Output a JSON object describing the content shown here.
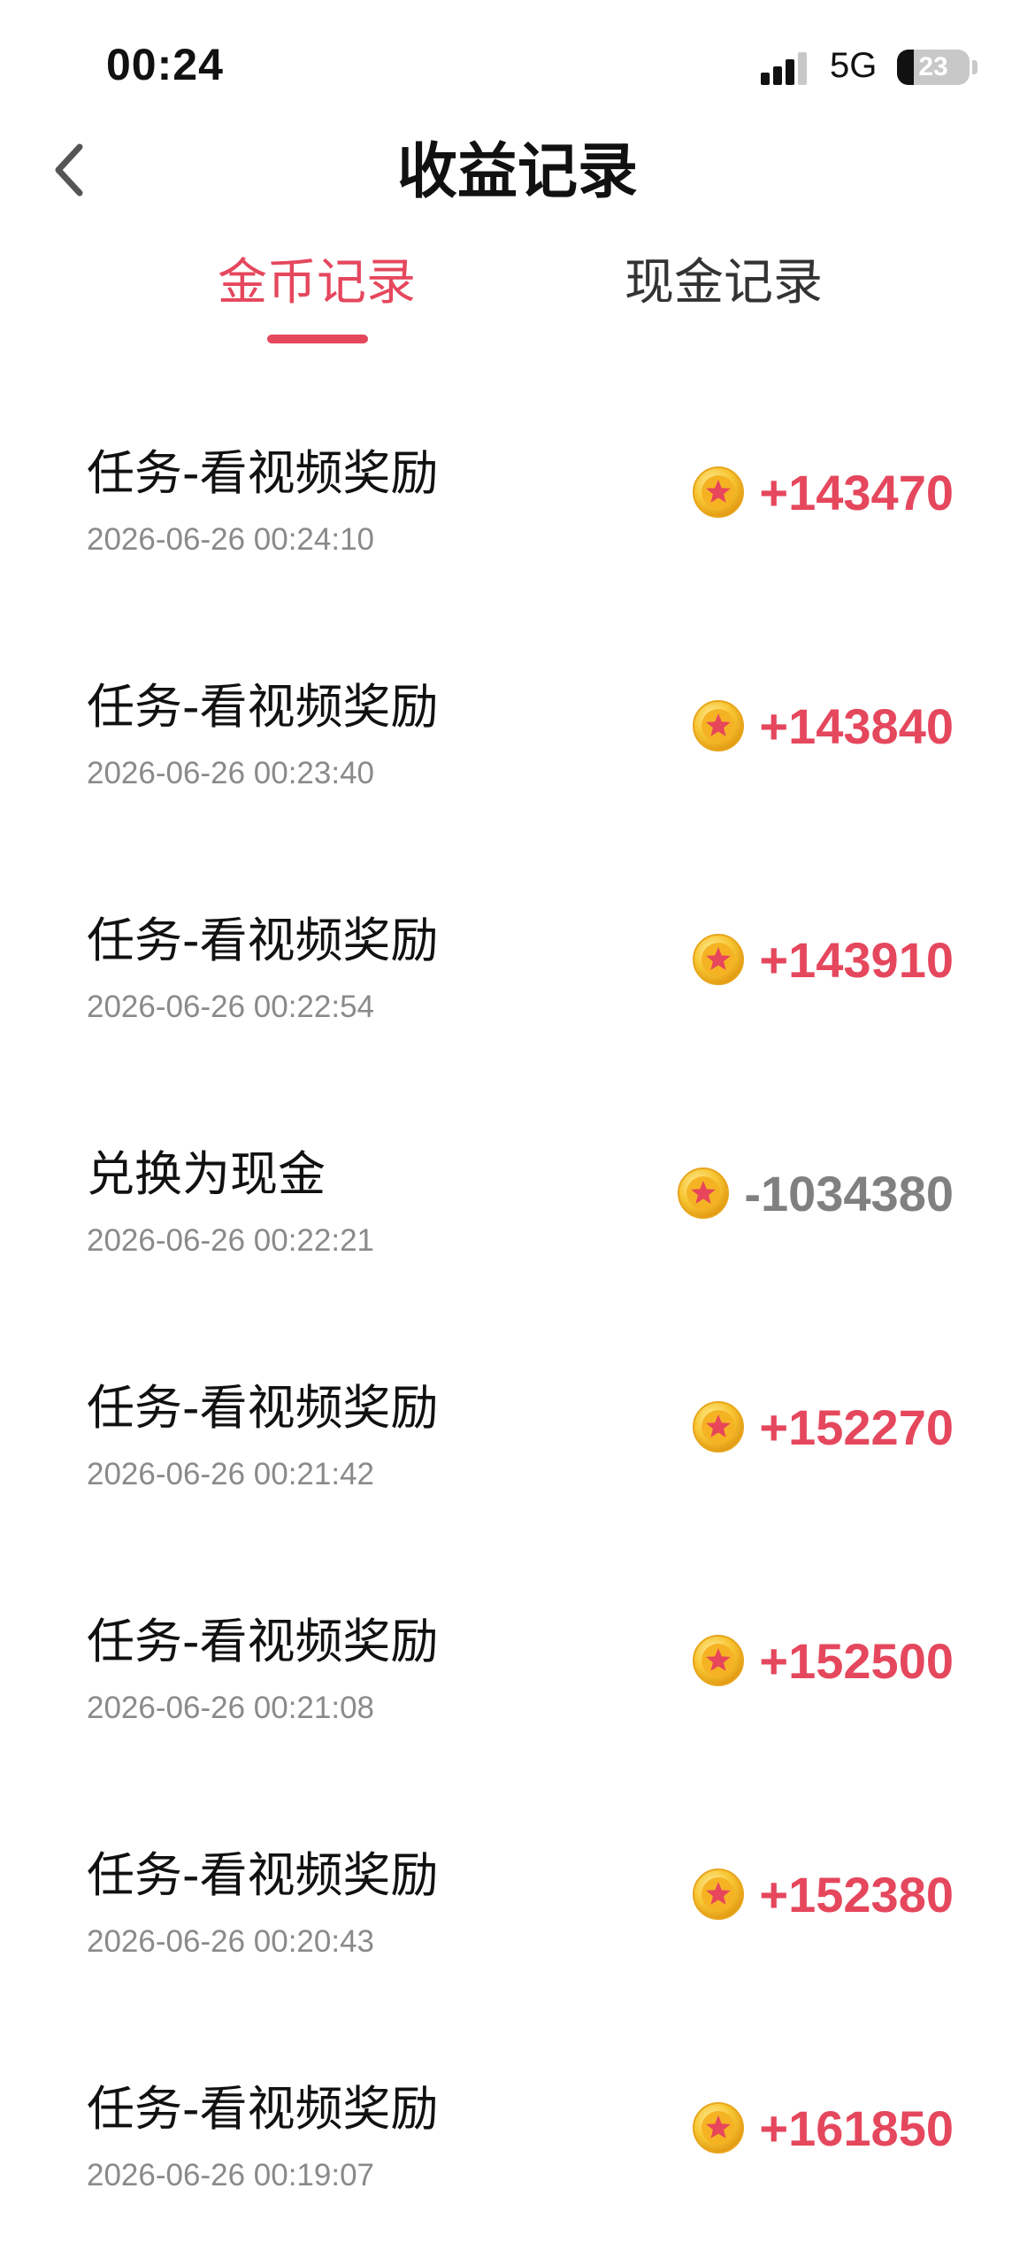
{
  "status_bar": {
    "time": "00:24",
    "network": "5G",
    "battery": "23",
    "battery_level_percent": 23
  },
  "nav": {
    "title": "收益记录",
    "back_icon": "chevron-left-icon"
  },
  "tabs": [
    {
      "label": "金币记录",
      "active": true
    },
    {
      "label": "现金记录",
      "active": false
    }
  ],
  "colors": {
    "accent": "#e5475d",
    "negative": "#808080",
    "muted": "#8a8a8a"
  },
  "records": [
    {
      "title": "任务-看视频奖励",
      "time": "2026-06-26 00:24:10",
      "amount": "+143470",
      "type": "income"
    },
    {
      "title": "任务-看视频奖励",
      "time": "2026-06-26 00:23:40",
      "amount": "+143840",
      "type": "income"
    },
    {
      "title": "任务-看视频奖励",
      "time": "2026-06-26 00:22:54",
      "amount": "+143910",
      "type": "income"
    },
    {
      "title": "兑换为现金",
      "time": "2026-06-26 00:22:21",
      "amount": "-1034380",
      "type": "expense"
    },
    {
      "title": "任务-看视频奖励",
      "time": "2026-06-26 00:21:42",
      "amount": "+152270",
      "type": "income"
    },
    {
      "title": "任务-看视频奖励",
      "time": "2026-06-26 00:21:08",
      "amount": "+152500",
      "type": "income"
    },
    {
      "title": "任务-看视频奖励",
      "time": "2026-06-26 00:20:43",
      "amount": "+152380",
      "type": "income"
    },
    {
      "title": "任务-看视频奖励",
      "time": "2026-06-26 00:19:07",
      "amount": "+161850",
      "type": "income"
    }
  ]
}
